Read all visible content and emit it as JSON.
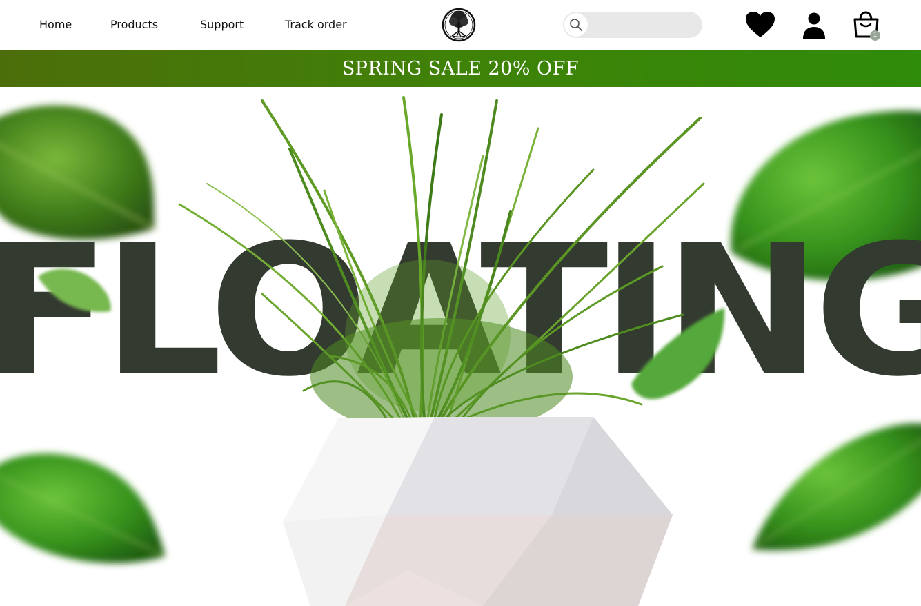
{
  "nav": {
    "items": [
      {
        "label": "Home"
      },
      {
        "label": "Products"
      },
      {
        "label": "Support"
      },
      {
        "label": "Track order"
      }
    ]
  },
  "search": {
    "placeholder": "",
    "value": ""
  },
  "cart": {
    "count": "1"
  },
  "banner": {
    "text": "SPRING SALE 20% OFF"
  },
  "hero": {
    "headline": "FLOATING"
  },
  "colors": {
    "banner_start": "#4c6e0a",
    "banner_end": "#2f8b0a",
    "headline": "#333a30",
    "leaf": "#3f9a1e"
  },
  "icons": [
    "tree-logo-icon",
    "search-icon",
    "heart-icon",
    "user-icon",
    "shopping-bag-icon"
  ]
}
